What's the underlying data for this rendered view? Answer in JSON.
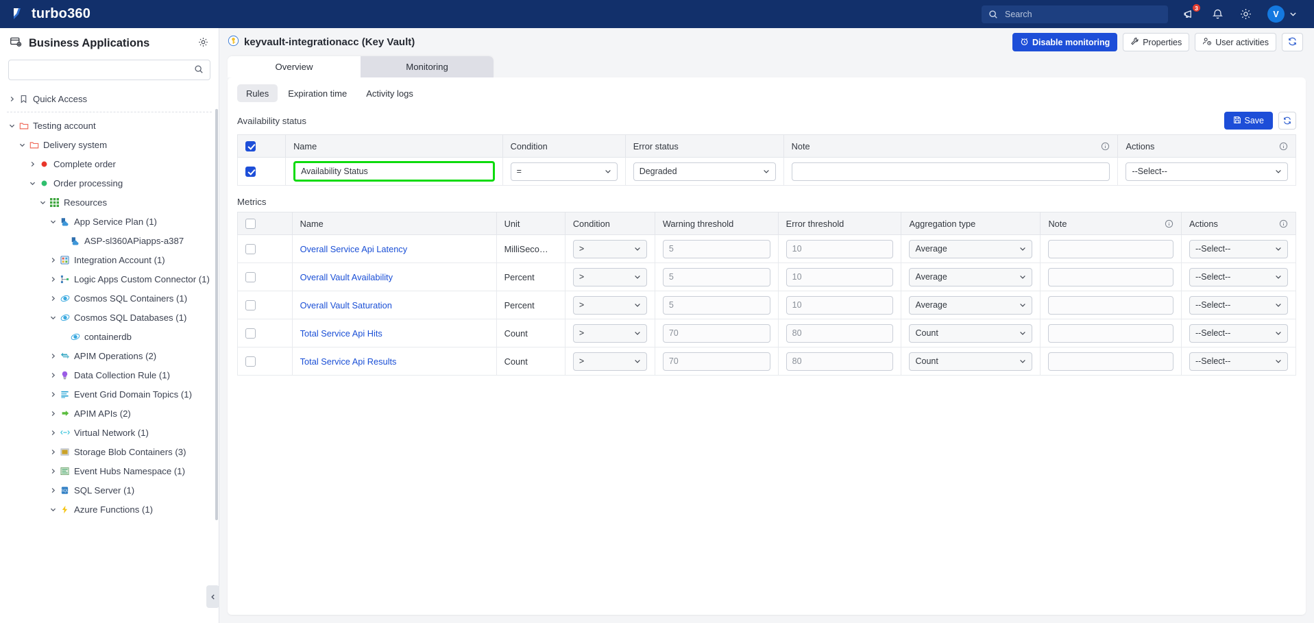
{
  "topbar": {
    "brand": "turbo360",
    "search_placeholder": "Search",
    "search_value": "",
    "announcements_badge": "3",
    "avatar_initial": "V",
    "icons": {
      "announcement": "announcement-icon",
      "bell": "bell-icon",
      "gear": "gear-icon",
      "chevron": "chevron-down-icon"
    }
  },
  "sidebar": {
    "title": "Business Applications",
    "search_placeholder": "",
    "search_value": "",
    "tree": [
      {
        "label": "Quick Access",
        "indent": 0,
        "state": "collapsed",
        "icon": "bookmark-icon",
        "icon_color": "#4b5160"
      },
      {
        "divider": true
      },
      {
        "label": "Testing account",
        "indent": 0,
        "state": "expanded",
        "icon": "folder-icon",
        "icon_color": "#ef6a5a"
      },
      {
        "label": "Delivery system",
        "indent": 1,
        "state": "expanded",
        "icon": "folder-icon",
        "icon_color": "#ef6a5a"
      },
      {
        "label": "Complete order",
        "indent": 2,
        "state": "collapsed",
        "icon": "dot-icon",
        "icon_color": "#e8362a"
      },
      {
        "label": "Order processing",
        "indent": 2,
        "state": "expanded",
        "icon": "dot-icon",
        "icon_color": "#2fbf6e"
      },
      {
        "label": "Resources",
        "indent": 3,
        "state": "expanded",
        "icon": "grid-icon",
        "icon_color": "#3fa63f"
      },
      {
        "label": "App Service Plan (1)",
        "indent": 4,
        "state": "expanded",
        "icon": "app-service-plan-icon",
        "icon_color": "#3e97d9"
      },
      {
        "label": "ASP-sl360APiapps-a387",
        "indent": 5,
        "state": "leaf",
        "icon": "app-service-plan-icon",
        "icon_color": "#3e97d9"
      },
      {
        "label": "Integration Account (1)",
        "indent": 4,
        "state": "collapsed",
        "icon": "integration-account-icon",
        "icon_color": "#3d7fbd"
      },
      {
        "label": "Logic Apps Custom Connector (1)",
        "indent": 4,
        "state": "collapsed",
        "icon": "logic-apps-connector-icon",
        "icon_color": "#3dbd6e"
      },
      {
        "label": "Cosmos SQL Containers (1)",
        "indent": 4,
        "state": "collapsed",
        "icon": "cosmos-db-icon",
        "icon_color": "#3aa9e0"
      },
      {
        "label": "Cosmos SQL Databases (1)",
        "indent": 4,
        "state": "expanded",
        "icon": "cosmos-db-icon",
        "icon_color": "#3aa9e0"
      },
      {
        "label": "containerdb",
        "indent": 5,
        "state": "leaf",
        "icon": "cosmos-db-icon",
        "icon_color": "#3aa9e0"
      },
      {
        "label": "APIM Operations (2)",
        "indent": 4,
        "state": "collapsed",
        "icon": "apim-operations-icon",
        "icon_color": "#3aa9c4"
      },
      {
        "label": "Data Collection Rule (1)",
        "indent": 4,
        "state": "collapsed",
        "icon": "data-collection-rule-icon",
        "icon_color": "#9b5de5"
      },
      {
        "label": "Event Grid Domain Topics (1)",
        "indent": 4,
        "state": "collapsed",
        "icon": "event-grid-icon",
        "icon_color": "#1f9ed1"
      },
      {
        "label": "APIM APIs (2)",
        "indent": 4,
        "state": "collapsed",
        "icon": "apim-apis-icon",
        "icon_color": "#5bbd3f"
      },
      {
        "label": "Virtual Network (1)",
        "indent": 4,
        "state": "collapsed",
        "icon": "virtual-network-icon",
        "icon_color": "#3ec6dd"
      },
      {
        "label": "Storage Blob Containers (3)",
        "indent": 4,
        "state": "collapsed",
        "icon": "storage-blob-icon",
        "icon_color": "#c9a227"
      },
      {
        "label": "Event Hubs Namespace (1)",
        "indent": 4,
        "state": "collapsed",
        "icon": "event-hubs-icon",
        "icon_color": "#3fa86b"
      },
      {
        "label": "SQL Server (1)",
        "indent": 4,
        "state": "collapsed",
        "icon": "sql-server-icon",
        "icon_color": "#2f7ec4"
      },
      {
        "label": "Azure Functions (1)",
        "indent": 4,
        "state": "expanded",
        "icon": "azure-functions-icon",
        "icon_color": "#f5c518"
      }
    ]
  },
  "page": {
    "title": "keyvault-integrationacc (Key Vault)",
    "title_icon": "key-vault-icon",
    "actions": [
      {
        "label": "Disable monitoring",
        "icon": "alarm-icon",
        "style": "primary"
      },
      {
        "label": "Properties",
        "icon": "wrench-icon",
        "style": "default"
      },
      {
        "label": "User activities",
        "icon": "user-clock-icon",
        "style": "default"
      }
    ],
    "refresh_icon": "refresh-icon",
    "tabs": [
      {
        "label": "Overview",
        "active": false
      },
      {
        "label": "Monitoring",
        "active": true
      }
    ],
    "subtabs": [
      {
        "label": "Rules",
        "active": true
      },
      {
        "label": "Expiration time",
        "active": false
      },
      {
        "label": "Activity logs",
        "active": false
      }
    ]
  },
  "availability": {
    "section_title": "Availability status",
    "save_label": "Save",
    "save_icon": "save-icon",
    "refresh_icon": "refresh-icon",
    "headers": [
      "Name",
      "Condition",
      "Error status",
      "Note",
      "Actions"
    ],
    "header_all_checked": true,
    "rows": [
      {
        "checked": true,
        "name": "Availability Status",
        "name_highlighted": true,
        "condition": "=",
        "error_status": "Degraded",
        "note": "",
        "note_placeholder": "",
        "action": "--Select--"
      }
    ]
  },
  "metrics": {
    "section_title": "Metrics",
    "headers": [
      "Name",
      "Unit",
      "Condition",
      "Warning threshold",
      "Error threshold",
      "Aggregation type",
      "Note",
      "Actions"
    ],
    "header_all_checked": false,
    "rows": [
      {
        "checked": false,
        "name": "Overall Service Api Latency",
        "unit": "MilliSeco…",
        "condition": ">",
        "warning_threshold": "5",
        "error_threshold": "10",
        "aggregation_type": "Average",
        "note": "",
        "action": "--Select--"
      },
      {
        "checked": false,
        "name": "Overall Vault Availability",
        "unit": "Percent",
        "condition": ">",
        "warning_threshold": "5",
        "error_threshold": "10",
        "aggregation_type": "Average",
        "note": "",
        "action": "--Select--"
      },
      {
        "checked": false,
        "name": "Overall Vault Saturation",
        "unit": "Percent",
        "condition": ">",
        "warning_threshold": "5",
        "error_threshold": "10",
        "aggregation_type": "Average",
        "note": "",
        "action": "--Select--"
      },
      {
        "checked": false,
        "name": "Total Service Api Hits",
        "unit": "Count",
        "condition": ">",
        "warning_threshold": "70",
        "error_threshold": "80",
        "aggregation_type": "Count",
        "note": "",
        "action": "--Select--"
      },
      {
        "checked": false,
        "name": "Total Service Api Results",
        "unit": "Count",
        "condition": ">",
        "warning_threshold": "70",
        "error_threshold": "80",
        "aggregation_type": "Count",
        "note": "",
        "action": "--Select--"
      }
    ]
  },
  "colors": {
    "brand_navy": "#12306b",
    "primary_blue": "#1d4ed8",
    "link_blue": "#1a4fd6",
    "highlight_green": "#0ddb0d",
    "badge_red": "#e03b2f"
  }
}
